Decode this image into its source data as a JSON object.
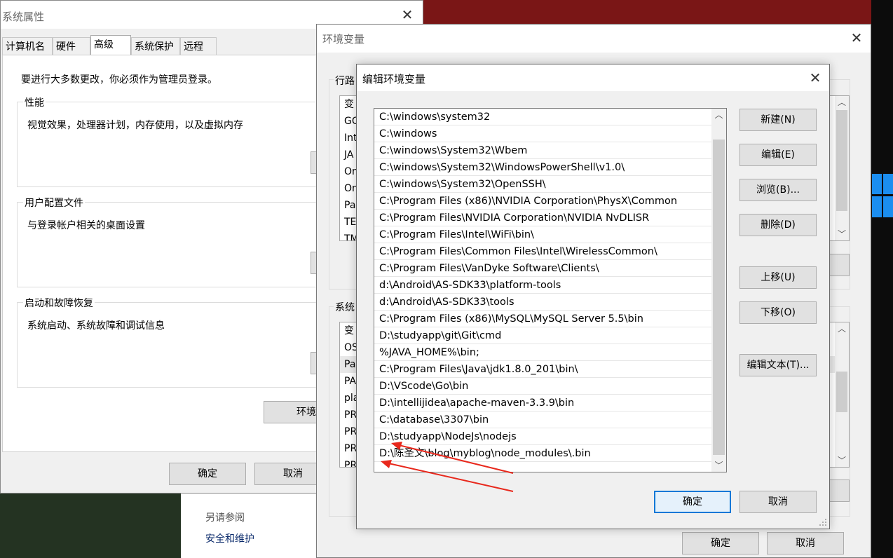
{
  "system_properties": {
    "title": "系统属性",
    "tabs": [
      {
        "label": "计算机名"
      },
      {
        "label": "硬件"
      },
      {
        "label": "高级"
      },
      {
        "label": "系统保护"
      },
      {
        "label": "远程"
      }
    ],
    "admin_note": "要进行大多数更改，你必须作为管理员登录。",
    "groups": [
      {
        "title": "性能",
        "desc": "视觉效果，处理器计划，内存使用，以及虚拟内存"
      },
      {
        "title": "用户配置文件",
        "desc": "与登录帐户相关的桌面设置"
      },
      {
        "title": "启动和故障恢复",
        "desc": "系统启动、系统故障和调试信息"
      }
    ],
    "env_button": "环境",
    "ok": "确定",
    "cancel": "取消"
  },
  "see_also": {
    "header": "另请参阅",
    "link": "安全和维护"
  },
  "env_vars": {
    "title": "环境变量",
    "user_section_label": "行路",
    "system_section_label": "系统",
    "user_rows": [
      "变",
      "GO",
      "Int",
      "JA",
      "On",
      "On",
      "Pa",
      "TE",
      "TM"
    ],
    "system_rows": [
      "变",
      "OS",
      "Pa",
      "PA",
      "pla",
      "PR",
      "PR",
      "PR",
      "PR"
    ],
    "ok": "确定",
    "cancel": "取消"
  },
  "edit_env": {
    "title": "编辑环境变量",
    "paths": [
      "C:\\windows\\system32",
      "C:\\windows",
      "C:\\windows\\System32\\Wbem",
      "C:\\windows\\System32\\WindowsPowerShell\\v1.0\\",
      "C:\\windows\\System32\\OpenSSH\\",
      "C:\\Program Files (x86)\\NVIDIA Corporation\\PhysX\\Common",
      "C:\\Program Files\\NVIDIA Corporation\\NVIDIA NvDLISR",
      "C:\\Program Files\\Intel\\WiFi\\bin\\",
      "C:\\Program Files\\Common Files\\Intel\\WirelessCommon\\",
      "C:\\Program Files\\VanDyke Software\\Clients\\",
      "d:\\Android\\AS-SDK33\\platform-tools",
      "d:\\Android\\AS-SDK33\\tools",
      "C:\\Program Files (x86)\\MySQL\\MySQL Server 5.5\\bin",
      "D:\\studyapp\\git\\Git\\cmd",
      "%JAVA_HOME%\\bin;",
      "C:\\Program Files\\Java\\jdk1.8.0_201\\bin\\",
      "D:\\VScode\\Go\\bin",
      "D:\\intellijidea\\apache-maven-3.3.9\\bin",
      "C:\\database\\3307\\bin",
      "D:\\studyapp\\NodeJs\\nodejs",
      "D:\\陈圣文\\blog\\myblog\\node_modules\\.bin"
    ],
    "buttons": {
      "new": "新建(N)",
      "edit": "编辑(E)",
      "browse": "浏览(B)...",
      "delete": "删除(D)",
      "move_up": "上移(U)",
      "move_down": "下移(O)",
      "edit_text": "编辑文本(T)..."
    },
    "ok": "确定",
    "cancel": "取消"
  },
  "colors": {
    "arrow": "#e8281c",
    "accent": "#0078d7"
  }
}
